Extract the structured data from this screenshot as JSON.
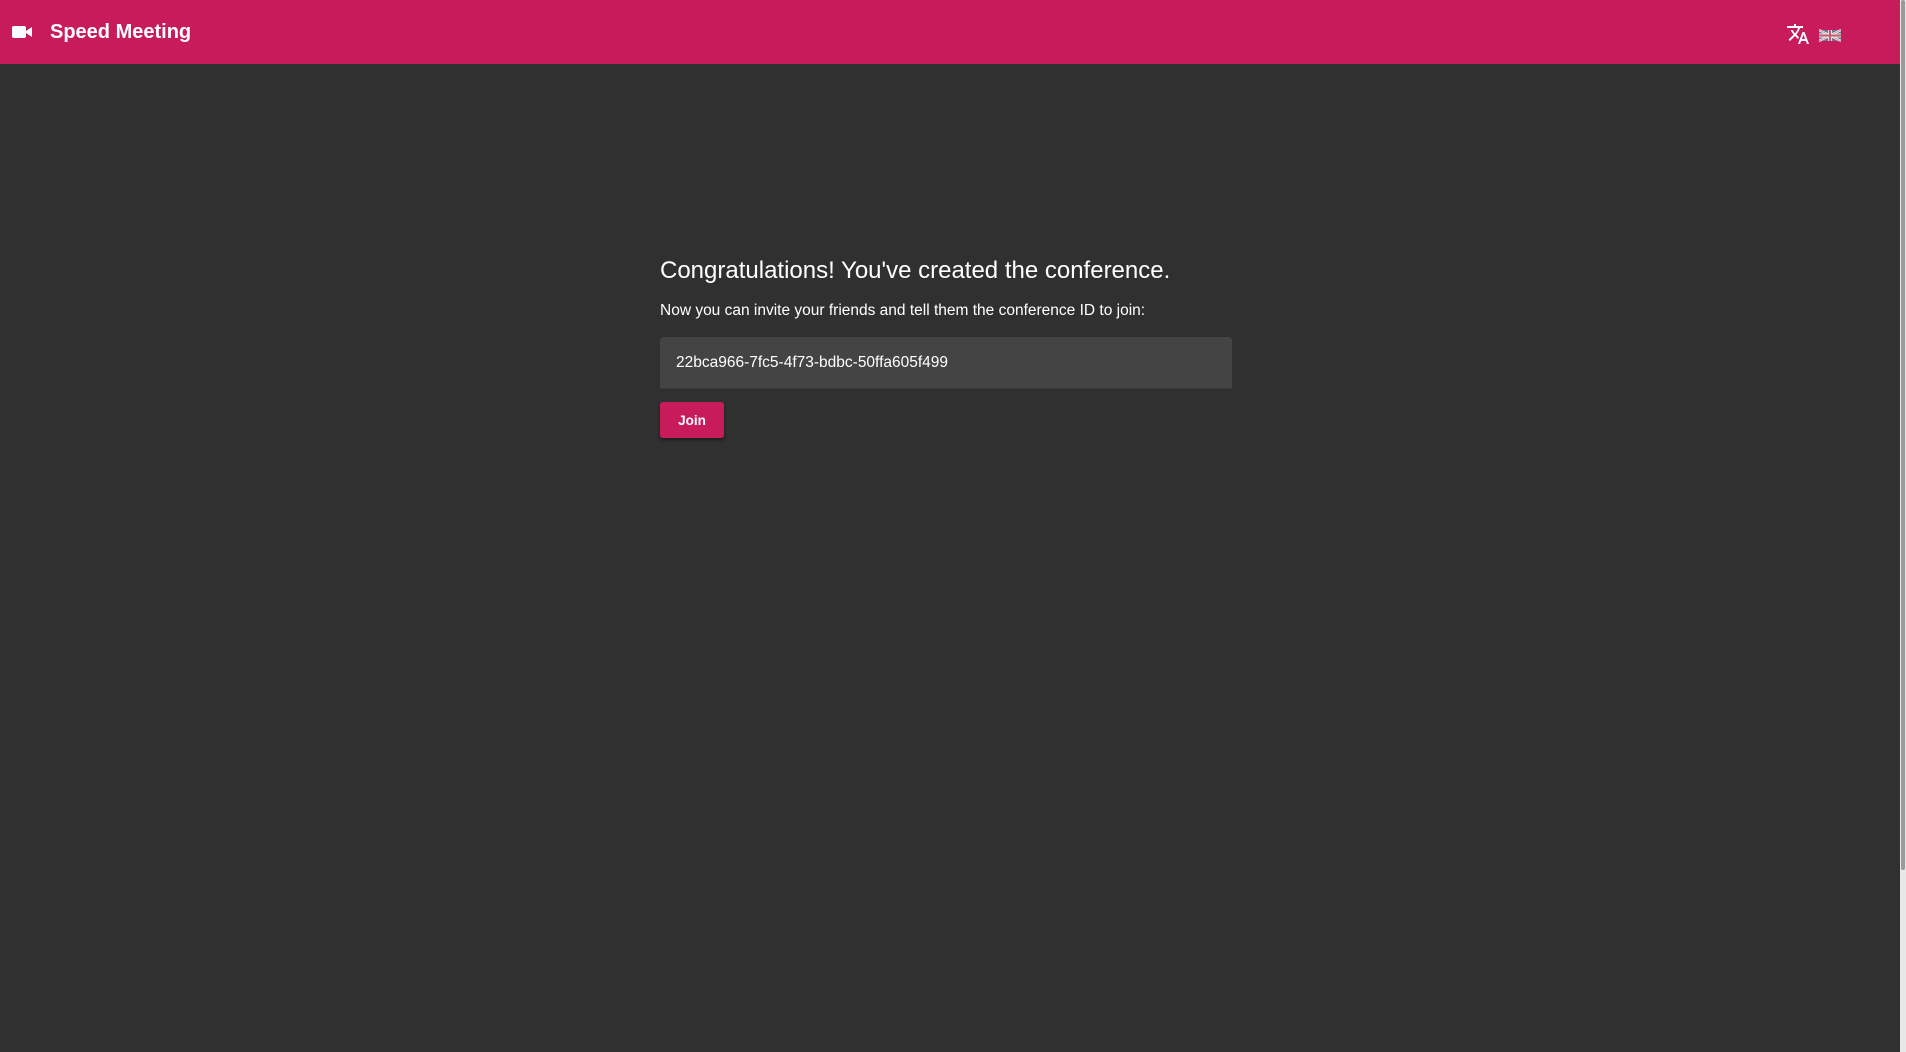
{
  "app": {
    "title": "Speed Meeting",
    "icon": "videocam-icon",
    "accent_color": "#c81b5c",
    "background_color": "#303030"
  },
  "toolbar": {
    "language_icon": "translate-icon",
    "language_flag": "uk-flag-icon"
  },
  "main": {
    "heading": "Congratulations! You've created the conference.",
    "instructions": "Now you can invite your friends and tell them the conference ID to join:",
    "conference_id": "22bca966-7fc5-4f73-bdbc-50ffa605f499",
    "join_label": "Join"
  }
}
